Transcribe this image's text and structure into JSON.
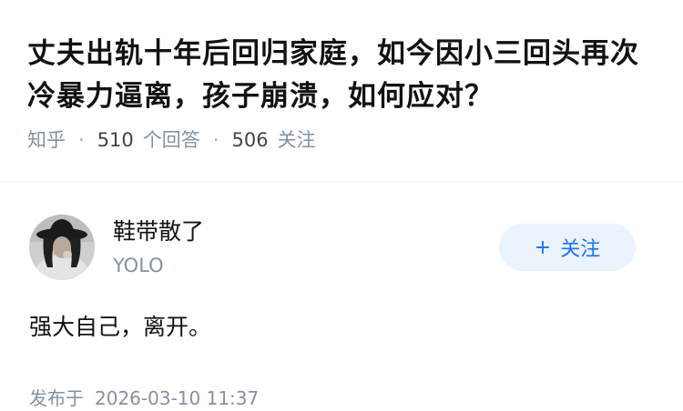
{
  "question": {
    "title": "丈夫出轨十年后回归家庭，如今因小三回头再次冷暴力逼离，孩子崩溃，如何应对？",
    "source": "知乎",
    "answers_count": "510",
    "answers_label": "个回答",
    "followers_count": "506",
    "followers_label": "关注"
  },
  "answer": {
    "author_name": "鞋带散了",
    "author_headline": "YOLO",
    "follow_button_label": "关注",
    "follow_button_icon": "plus-icon",
    "content": "强大自己，离开。",
    "published_label": "发布于",
    "published_time": "2026-03-10 11:37"
  },
  "colors": {
    "accent": "#1772f6",
    "follow_bg": "#ebf3fc",
    "meta_gray": "#8590a6",
    "text": "#121212"
  }
}
